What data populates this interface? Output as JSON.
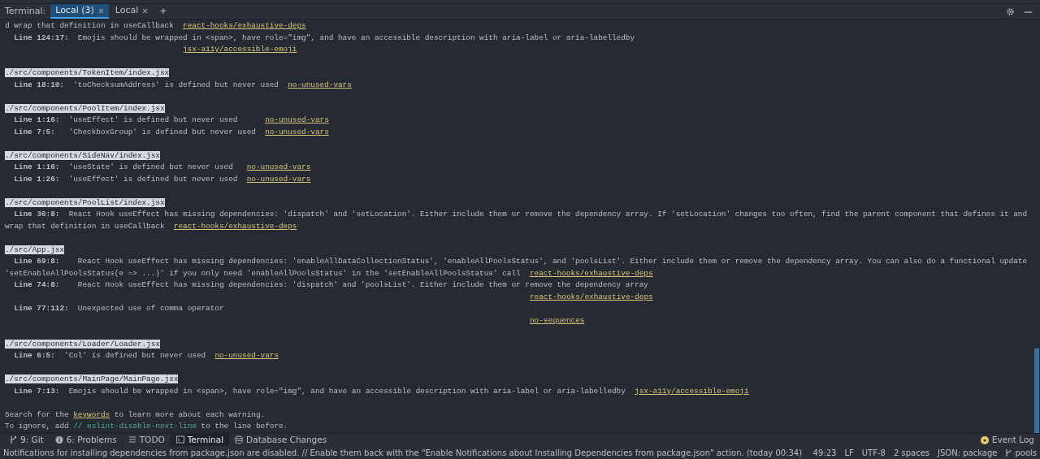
{
  "terminal_header": {
    "label": "Terminal:",
    "tabs": [
      {
        "label": "Local (3)",
        "selected": true
      },
      {
        "label": "Local",
        "selected": false
      }
    ],
    "add": "+"
  },
  "terminal": {
    "lines": [
      {
        "kind": "text",
        "segments": [
          {
            "kind": "plain",
            "text": "d wrap that definition in useCallback  "
          },
          {
            "kind": "link",
            "text": "react-hooks/exhaustive-deps"
          }
        ]
      },
      {
        "kind": "entry",
        "segments": [
          {
            "kind": "bold",
            "text": "Line 124:17:  "
          },
          {
            "kind": "plain",
            "text": "Emojis should be wrapped in <span>, have role=\"img\", and have an accessible description with aria-label or aria-labelledby"
          }
        ]
      },
      {
        "kind": "continuation",
        "segments": [
          {
            "kind": "link",
            "text": "jsx-a11y/accessible-emoji"
          }
        ]
      },
      {
        "kind": "blank"
      },
      {
        "kind": "text",
        "segments": [
          {
            "kind": "path",
            "text": "./src/components/TokenItem/index.jsx"
          }
        ]
      },
      {
        "kind": "entry",
        "segments": [
          {
            "kind": "bold",
            "text": "Line 18:10:  "
          },
          {
            "kind": "plain",
            "text": "'toChecksumAddress' is defined but never used  "
          },
          {
            "kind": "link",
            "text": "no-unused-vars"
          }
        ]
      },
      {
        "kind": "blank"
      },
      {
        "kind": "text",
        "segments": [
          {
            "kind": "path",
            "text": "./src/components/PoolItem/index.jsx"
          }
        ]
      },
      {
        "kind": "entry",
        "segments": [
          {
            "kind": "bold",
            "text": "Line 1:16:  "
          },
          {
            "kind": "plain",
            "text": "'useEffect' is defined but never used      "
          },
          {
            "kind": "link",
            "text": "no-unused-vars"
          }
        ]
      },
      {
        "kind": "entry",
        "segments": [
          {
            "kind": "bold",
            "text": "Line 7:5:   "
          },
          {
            "kind": "plain",
            "text": "'CheckboxGroup' is defined but never used  "
          },
          {
            "kind": "link",
            "text": "no-unused-vars"
          }
        ]
      },
      {
        "kind": "blank"
      },
      {
        "kind": "text",
        "segments": [
          {
            "kind": "path",
            "text": "./src/components/SideNav/index.jsx"
          }
        ]
      },
      {
        "kind": "entry",
        "segments": [
          {
            "kind": "bold",
            "text": "Line 1:16:  "
          },
          {
            "kind": "plain",
            "text": "'useState' is defined but never used   "
          },
          {
            "kind": "link",
            "text": "no-unused-vars"
          }
        ]
      },
      {
        "kind": "entry",
        "segments": [
          {
            "kind": "bold",
            "text": "Line 1:26:  "
          },
          {
            "kind": "plain",
            "text": "'useEffect' is defined but never used  "
          },
          {
            "kind": "link",
            "text": "no-unused-vars"
          }
        ]
      },
      {
        "kind": "blank"
      },
      {
        "kind": "text",
        "segments": [
          {
            "kind": "path",
            "text": "./src/components/PoolList/index.jsx"
          }
        ]
      },
      {
        "kind": "entry",
        "segments": [
          {
            "kind": "bold",
            "text": "Line 36:8:  "
          },
          {
            "kind": "plain",
            "text": "React Hook useEffect has missing dependencies: 'dispatch' and 'setLocation'. Either include them or remove the dependency array. If 'setLocation' changes too often, find the parent component that defines it and"
          }
        ]
      },
      {
        "kind": "text",
        "segments": [
          {
            "kind": "plain",
            "text": "wrap that definition in useCallback  "
          },
          {
            "kind": "link",
            "text": "react-hooks/exhaustive-deps"
          }
        ]
      },
      {
        "kind": "blank"
      },
      {
        "kind": "text",
        "segments": [
          {
            "kind": "path",
            "text": "./src/App.jsx"
          }
        ]
      },
      {
        "kind": "entry",
        "segments": [
          {
            "kind": "bold",
            "text": "Line 69:8:    "
          },
          {
            "kind": "plain",
            "text": "React Hook useEffect has missing dependencies: 'enableAllDataCollectionStatus', 'enableAllPoolsStatus', and 'poolsList'. Either include them or remove the dependency array. You can also do a functional update"
          }
        ]
      },
      {
        "kind": "text",
        "segments": [
          {
            "kind": "plain",
            "text": "'setEnableAllPoolsStatus(e => ...)' if you only need 'enableAllPoolsStatus' in the 'setEnableAllPoolsStatus' call  "
          },
          {
            "kind": "link",
            "text": "react-hooks/exhaustive-deps"
          }
        ]
      },
      {
        "kind": "entry",
        "segments": [
          {
            "kind": "bold",
            "text": "Line 74:8:    "
          },
          {
            "kind": "plain",
            "text": "React Hook useEffect has missing dependencies: 'dispatch' and 'poolsList'. Either include them or remove the dependency array"
          }
        ]
      },
      {
        "kind": "continuation",
        "segments": [
          {
            "kind": "link",
            "text": "react-hooks/exhaustive-deps"
          }
        ]
      },
      {
        "kind": "entry",
        "segments": [
          {
            "kind": "bold",
            "text": "Line 77:112:  "
          },
          {
            "kind": "plain",
            "text": "Unexpected use of comma operator"
          }
        ]
      },
      {
        "kind": "continuation",
        "segments": [
          {
            "kind": "link",
            "text": "no-sequences"
          }
        ]
      },
      {
        "kind": "blank"
      },
      {
        "kind": "text",
        "segments": [
          {
            "kind": "path",
            "text": "./src/components/Loader/Loader.jsx"
          }
        ]
      },
      {
        "kind": "entry",
        "segments": [
          {
            "kind": "bold",
            "text": "Line 6:5:  "
          },
          {
            "kind": "plain",
            "text": "'Col' is defined but never used  "
          },
          {
            "kind": "link",
            "text": "no-unused-vars"
          }
        ]
      },
      {
        "kind": "blank"
      },
      {
        "kind": "text",
        "segments": [
          {
            "kind": "path",
            "text": "./src/components/MainPage/MainPage.jsx"
          }
        ]
      },
      {
        "kind": "entry",
        "segments": [
          {
            "kind": "bold",
            "text": "Line 7:13:  "
          },
          {
            "kind": "plain",
            "text": "Emojis should be wrapped in <span>, have role=\"img\", and have an accessible description with aria-label or aria-labelledby  "
          },
          {
            "kind": "link",
            "text": "jsx-a11y/accessible-emoji"
          }
        ]
      },
      {
        "kind": "blank"
      },
      {
        "kind": "text",
        "segments": [
          {
            "kind": "plain",
            "text": "Search for the "
          },
          {
            "kind": "link",
            "text": "keywords"
          },
          {
            "kind": "plain",
            "text": " to learn more about each warning."
          }
        ]
      },
      {
        "kind": "text",
        "segments": [
          {
            "kind": "plain",
            "text": "To ignore, add "
          },
          {
            "kind": "comment",
            "text": "// eslint-disable-next-line"
          },
          {
            "kind": "plain",
            "text": " to the line before."
          }
        ]
      }
    ]
  },
  "tool_windows": [
    {
      "label": "9: Git",
      "selected": false
    },
    {
      "label": "6: Problems",
      "selected": false
    },
    {
      "label": "TODO",
      "selected": false
    },
    {
      "label": "Terminal",
      "selected": true
    },
    {
      "label": "Database Changes",
      "selected": false
    }
  ],
  "event_log": "Event Log",
  "status_bar": {
    "message": "Notifications for installing dependencies from package.json are disabled. // Enable them back with the \"Enable Notifications about Installing Dependencies from package.json\" action. (today 00:34)",
    "items": [
      "49:23",
      "LF",
      "UTF-8",
      "2 spaces",
      "JSON: package"
    ],
    "branch": "pools"
  }
}
